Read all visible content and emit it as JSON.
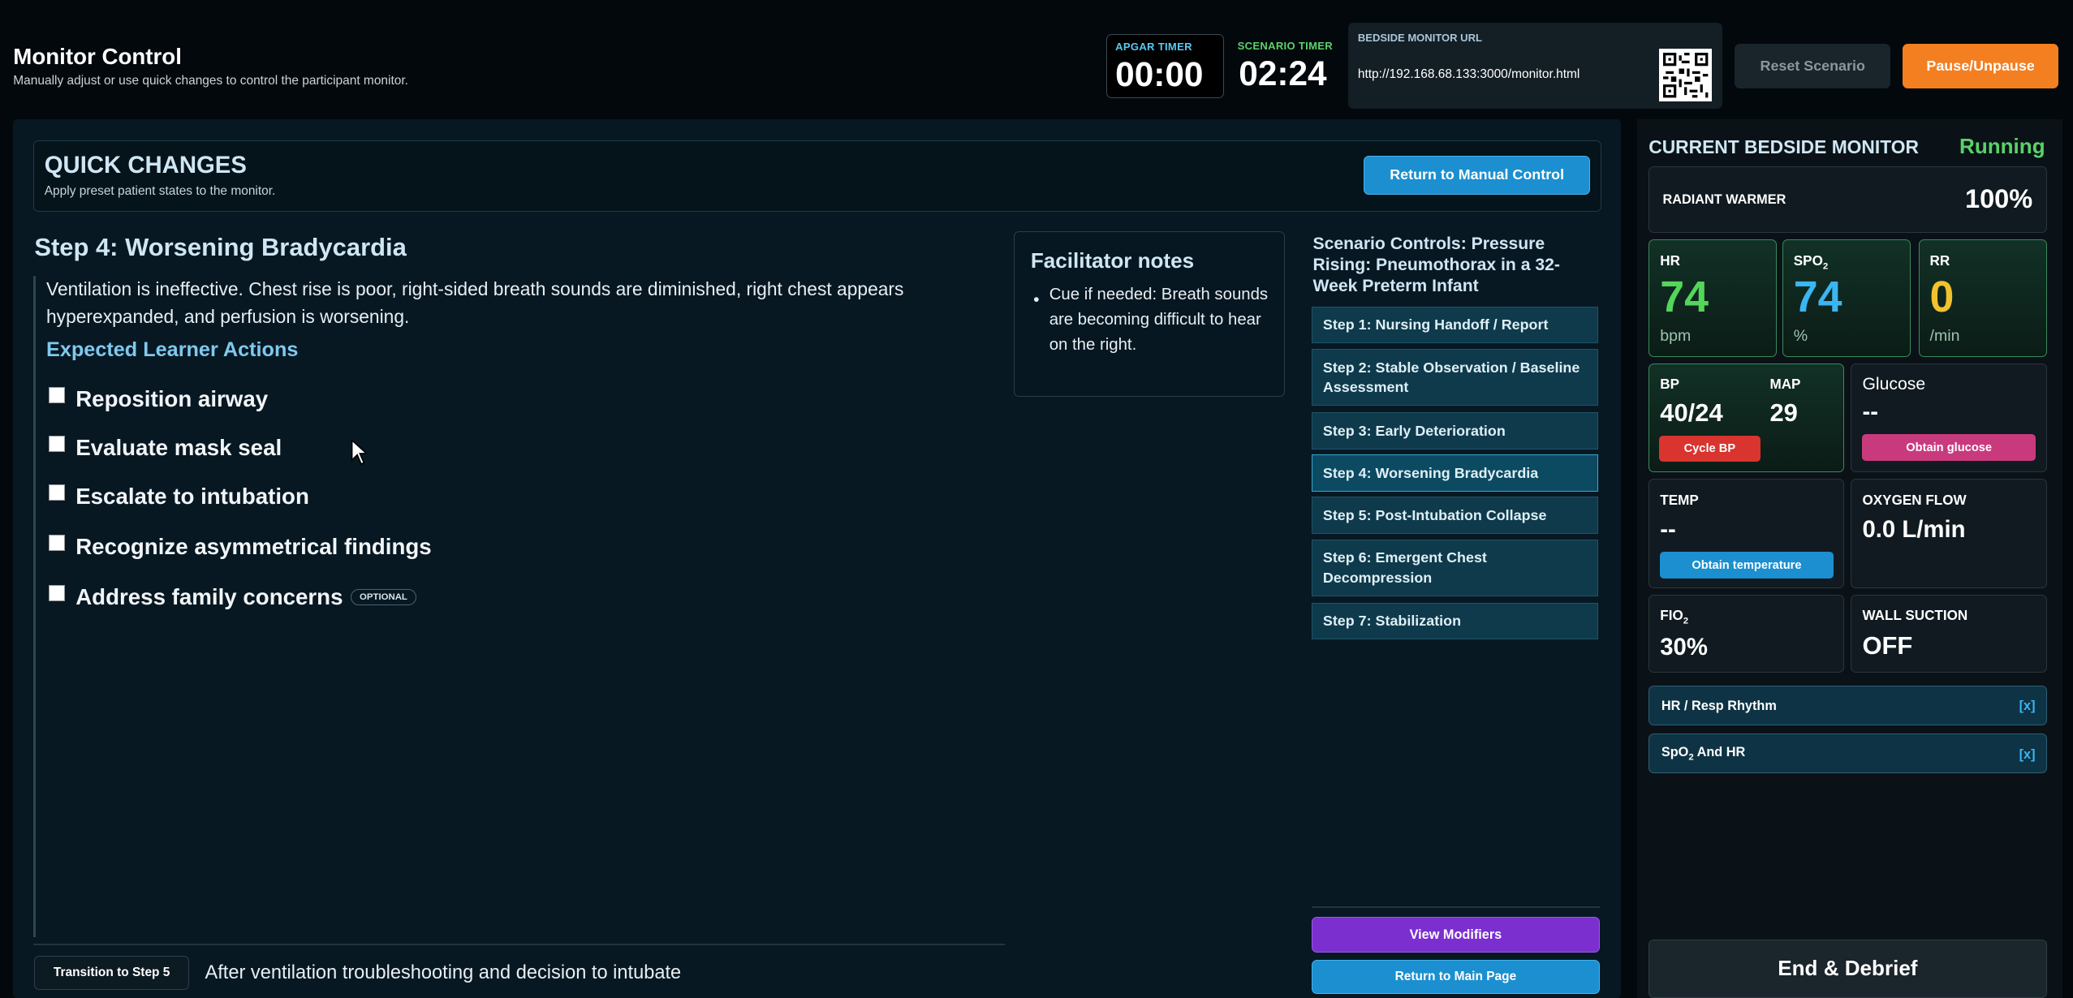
{
  "header": {
    "title": "Monitor Control",
    "subtitle": "Manually adjust or use quick changes to control the participant monitor.",
    "apgar_label": "APGAR TIMER",
    "apgar_value": "00:00",
    "scenario_label": "SCENARIO TIMER",
    "scenario_value": "02:24",
    "url_label": "BEDSIDE MONITOR URL",
    "url_value": "http://192.168.68.133:3000/monitor.html",
    "reset_label": "Reset Scenario",
    "pause_label": "Pause/Unpause"
  },
  "quick_changes": {
    "title": "QUICK CHANGES",
    "subtitle": "Apply preset patient states to the monitor.",
    "return_label": "Return to Manual Control"
  },
  "step": {
    "title": "Step 4: Worsening Bradycardia",
    "description": "Ventilation is ineffective. Chest rise is poor, right-sided breath sounds are diminished, right chest appears hyperexpanded, and perfusion is worsening.",
    "actions_heading": "Expected Learner Actions",
    "actions": [
      "Reposition airway",
      "Evaluate mask seal",
      "Escalate to intubation",
      "Recognize asymmetrical findings",
      "Address family concerns"
    ],
    "optional_badge": "OPTIONAL",
    "transition_label": "Transition to Step 5",
    "transition_text": "After ventilation troubleshooting and decision to intubate"
  },
  "notes": {
    "title": "Facilitator notes",
    "items": [
      "Cue if needed: Breath sounds are becoming difficult to hear on the right."
    ]
  },
  "scenario": {
    "title": "Scenario Controls: Pressure Rising: Pneumothorax in a 32-Week Preterm Infant",
    "steps": [
      "Step 1: Nursing Handoff / Report",
      "Step 2: Stable Observation / Baseline Assessment",
      "Step 3: Early Deterioration",
      "Step 4: Worsening Bradycardia",
      "Step 5: Post-Intubation Collapse",
      "Step 6: Emergent Chest Decompression",
      "Step 7: Stabilization"
    ],
    "active_step": 3,
    "view_modifiers_label": "View Modifiers",
    "return_main_label": "Return to Main Page"
  },
  "monitor": {
    "title": "CURRENT BEDSIDE MONITOR",
    "status": "Running",
    "warmer_label": "RADIANT WARMER",
    "warmer_value": "100%",
    "hr_label": "HR",
    "hr_value": "74",
    "hr_unit": "bpm",
    "spo2_label": "SPO",
    "spo2_sub": "2",
    "spo2_value": "74",
    "spo2_unit": "%",
    "rr_label": "RR",
    "rr_value": "0",
    "rr_unit": "/min",
    "bp_label": "BP",
    "bp_value": "40/24",
    "map_label": "MAP",
    "map_value": "29",
    "cycle_bp_label": "Cycle BP",
    "glucose_label": "Glucose",
    "glucose_value": "--",
    "obtain_glucose_label": "Obtain glucose",
    "temp_label": "TEMP",
    "temp_value": "--",
    "obtain_temp_label": "Obtain temperature",
    "oxygen_label": "OXYGEN FLOW",
    "oxygen_value": "0.0 L/min",
    "fio2_label": "FIO",
    "fio2_sub": "2",
    "fio2_value": "30%",
    "suction_label": "WALL SUCTION",
    "suction_value": "OFF",
    "rhythm1_label": "HR / Resp Rhythm",
    "rhythm2_label": "SpO",
    "rhythm2_sub": "2",
    "rhythm2_tail": " And HR",
    "close_label": "[x]",
    "end_label": "End & Debrief"
  },
  "colors": {
    "accent_blue": "#1b8fd0",
    "pause_orange": "#f47f20",
    "running_green": "#59d26a",
    "hr_green": "#53d65a",
    "spo2_blue": "#3ab6f2",
    "rr_yellow": "#f2c22e",
    "cycle_red": "#d9342e",
    "glucose_pink": "#c93a7d",
    "modifiers_purple": "#7b2fcf"
  }
}
